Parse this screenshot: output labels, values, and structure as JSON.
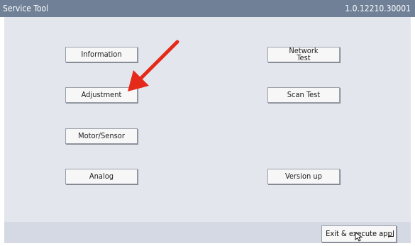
{
  "window": {
    "title": "Service Tool",
    "version": "1.0.12210.30001"
  },
  "buttons": {
    "information": "Information",
    "adjustment": "Adjustment",
    "motor_sensor": "Motor/Sensor",
    "analog": "Analog",
    "network_test_line1": "Network",
    "network_test_line2": "Test",
    "scan_test": "Scan Test",
    "version_up": "Version up"
  },
  "footer": {
    "exit_label": "Exit & execute app"
  },
  "colors": {
    "titlebar": "#6f8097",
    "panel": "#e4e6ed",
    "footer": "#d4d9e3",
    "annotation_arrow": "#e52a1a"
  },
  "icons": [
    "enter-icon",
    "mouse-cursor-icon",
    "red-arrow-annotation-icon"
  ]
}
